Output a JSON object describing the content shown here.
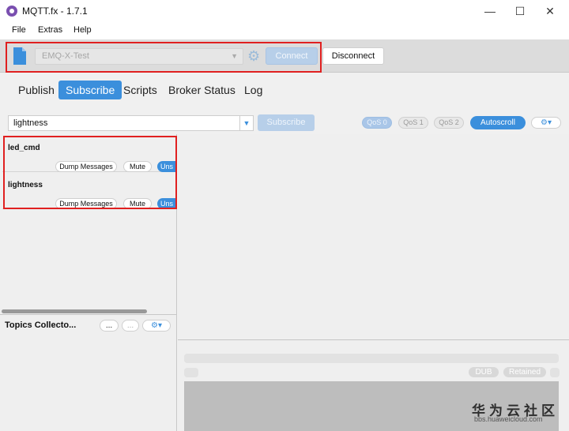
{
  "window": {
    "title": "MQTT.fx - 1.7.1",
    "minimize": "—",
    "maximize": "☐",
    "close": "✕"
  },
  "menu": [
    "File",
    "Extras",
    "Help"
  ],
  "connection": {
    "profile": "EMQ-X-Test",
    "connect_label": "Connect",
    "disconnect_label": "Disconnect"
  },
  "tabs": [
    "Publish",
    "Subscribe",
    "Scripts",
    "Broker Status",
    "Log"
  ],
  "active_tab": "Subscribe",
  "subscribe": {
    "topic_value": "lightness",
    "subscribe_label": "Subscribe",
    "qos": [
      "QoS 0",
      "QoS 1",
      "QoS 2"
    ],
    "qos_selected": "QoS 0",
    "autoscroll_label": "Autoscroll",
    "settings_label": "⚙▾"
  },
  "subscriptions": [
    {
      "topic": "led_cmd",
      "dump": "Dump Messages",
      "mute": "Mute",
      "unsub": "Uns"
    },
    {
      "topic": "lightness",
      "dump": "Dump Messages",
      "mute": "Mute",
      "unsub": "Uns"
    }
  ],
  "collector": {
    "title": "Topics Collecto...",
    "btn1": "...",
    "btn2": "...",
    "settings": "⚙▾"
  },
  "message": {
    "badge_dub": "DUB",
    "badge_retained": "Retained"
  },
  "watermark": {
    "line1": "华为云社区",
    "line2": "bbs.huaweicloud.com"
  },
  "colors": {
    "accent": "#3b8fdc",
    "highlight_box": "#e02020",
    "disabled_button": "#b7cfe9"
  }
}
